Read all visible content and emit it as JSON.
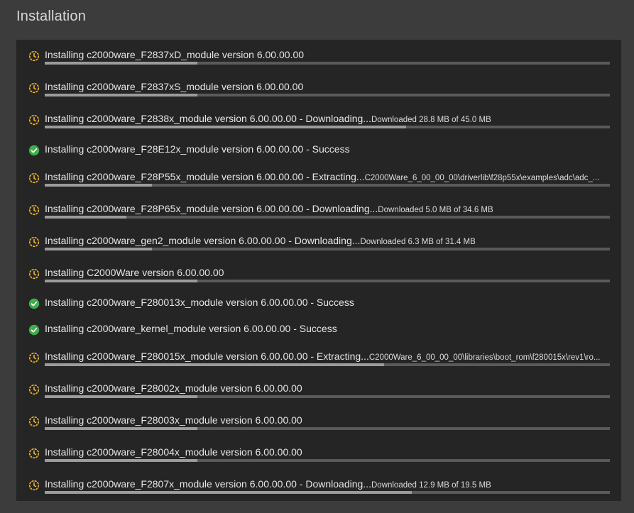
{
  "header": {
    "title": "Installation"
  },
  "colors": {
    "pending": "#f0b429",
    "success": "#3dae49",
    "bar_track": "#5a5a5a",
    "bar_fill": "#9b9b9b"
  },
  "items": [
    {
      "status": "pending",
      "icon": "clock-icon",
      "label": "Installing c2000ware_F2837xD_module version 6.00.00.00",
      "detail": "",
      "progress": 0.27
    },
    {
      "status": "pending",
      "icon": "clock-icon",
      "label": "Installing c2000ware_F2837xS_module version 6.00.00.00",
      "detail": "",
      "progress": 0.27
    },
    {
      "status": "pending",
      "icon": "clock-icon",
      "label": "Installing c2000ware_F2838x_module version 6.00.00.00 - Downloading...",
      "detail": "Downloaded 28.8 MB of 45.0 MB",
      "progress": 0.64
    },
    {
      "status": "success",
      "icon": "check-circle-icon",
      "label": "Installing c2000ware_F28E12x_module version 6.00.00.00 - Success",
      "detail": "",
      "progress": null
    },
    {
      "status": "pending",
      "icon": "clock-icon",
      "label": "Installing c2000ware_F28P55x_module version 6.00.00.00 - Extracting...",
      "detail": "C2000Ware_6_00_00_00\\driverlib\\f28p55x\\examples\\adc\\adc_...",
      "progress": 0.19
    },
    {
      "status": "pending",
      "icon": "clock-icon",
      "label": "Installing c2000ware_F28P65x_module version 6.00.00.00 - Downloading...",
      "detail": "Downloaded 5.0 MB of 34.6 MB",
      "progress": 0.145
    },
    {
      "status": "pending",
      "icon": "clock-icon",
      "label": "Installing c2000ware_gen2_module version 6.00.00.00 - Downloading...",
      "detail": "Downloaded 6.3 MB of 31.4 MB",
      "progress": 0.19
    },
    {
      "status": "pending",
      "icon": "clock-icon",
      "label": "Installing C2000Ware version 6.00.00.00",
      "detail": "",
      "progress": 0.27
    },
    {
      "status": "success",
      "icon": "check-circle-icon",
      "label": "Installing c2000ware_F280013x_module version 6.00.00.00 - Success",
      "detail": "",
      "progress": null
    },
    {
      "status": "success",
      "icon": "check-circle-icon",
      "label": "Installing c2000ware_kernel_module version 6.00.00.00 - Success",
      "detail": "",
      "progress": null
    },
    {
      "status": "pending",
      "icon": "clock-icon",
      "label": "Installing c2000ware_F280015x_module version 6.00.00.00 - Extracting...",
      "detail": "C2000Ware_6_00_00_00\\libraries\\boot_rom\\f280015x\\rev1\\ro...",
      "progress": 0.6
    },
    {
      "status": "pending",
      "icon": "clock-icon",
      "label": "Installing c2000ware_F28002x_module version 6.00.00.00",
      "detail": "",
      "progress": 0.27
    },
    {
      "status": "pending",
      "icon": "clock-icon",
      "label": "Installing c2000ware_F28003x_module version 6.00.00.00",
      "detail": "",
      "progress": 0.27
    },
    {
      "status": "pending",
      "icon": "clock-icon",
      "label": "Installing c2000ware_F28004x_module version 6.00.00.00",
      "detail": "",
      "progress": 0.27
    },
    {
      "status": "pending",
      "icon": "clock-icon",
      "label": "Installing c2000ware_F2807x_module version 6.00.00.00 - Downloading...",
      "detail": "Downloaded 12.9 MB of 19.5 MB",
      "progress": 0.65
    }
  ]
}
